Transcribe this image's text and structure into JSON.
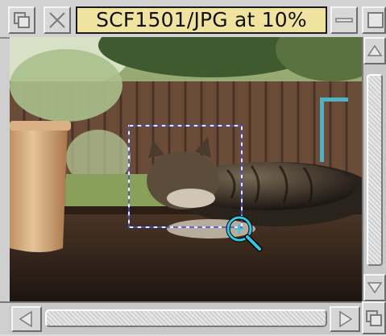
{
  "window": {
    "title": "SCF1501/JPG at 10%"
  },
  "titlebar": {
    "back_icon": "back-icon",
    "close_icon": "close-icon",
    "iconise_icon": "iconise-icon",
    "toggle_size_icon": "toggle-size-icon"
  },
  "image_view": {
    "description_icon": "magnifier-icon",
    "selection_color": "#33c7e0"
  },
  "scrollbars": {
    "up_arrow_icon": "arrow-up-icon",
    "down_arrow_icon": "arrow-down-icon",
    "left_arrow_icon": "arrow-left-icon",
    "right_arrow_icon": "arrow-right-icon",
    "resize_icon": "resize-icon"
  },
  "colors": {
    "title_background": "#f0e3a0",
    "window_chrome": "#d2d2d2"
  }
}
